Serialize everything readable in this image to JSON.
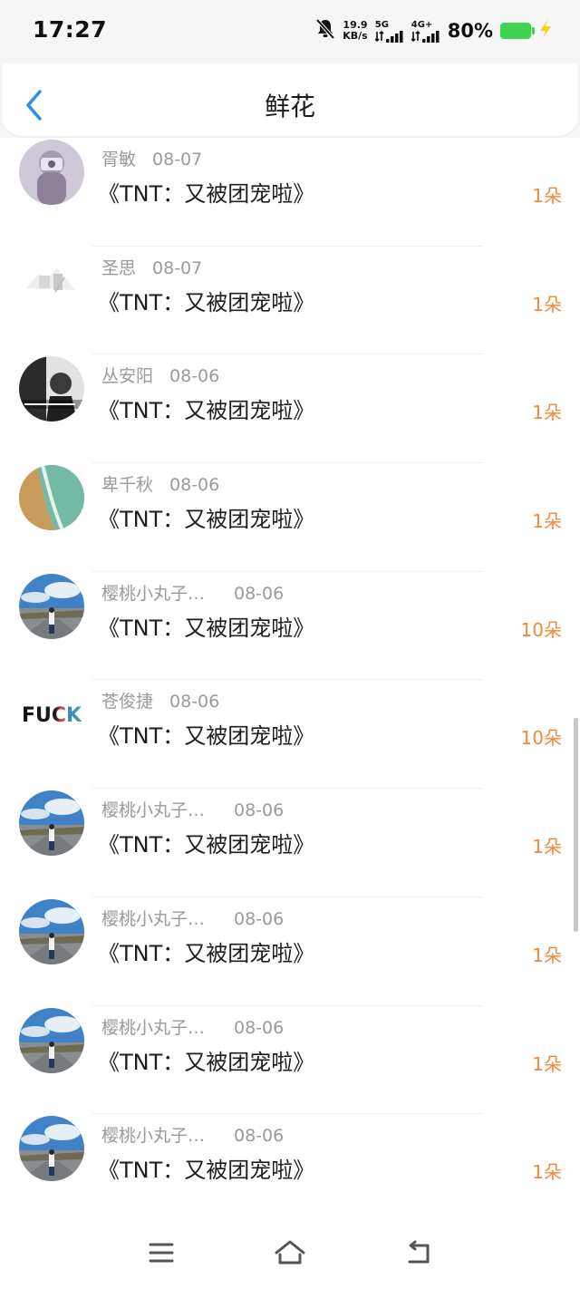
{
  "status_bar": {
    "time": "17:27",
    "net_speed_value": "19.9",
    "net_speed_unit": "KB/s",
    "sim1_label": "5G",
    "sim2_label": "4G+",
    "battery_percent": "80%",
    "icons": [
      "bell-muted-icon",
      "signal-icon",
      "battery-icon",
      "charging-bolt-icon"
    ]
  },
  "header": {
    "title": "鲜花",
    "back_icon": "chevron-left-icon"
  },
  "colors": {
    "accent_blue": "#2f8ee8",
    "count_orange": "#f08a3a",
    "battery_green": "#3fd452"
  },
  "items": [
    {
      "name": "胥敏",
      "date": "08-07",
      "book": "《TNT：又被团宠啦》",
      "count": "1朵",
      "avatar": "blurred-photo-avatar"
    },
    {
      "name": "圣思",
      "date": "08-07",
      "book": "《TNT：又被团宠啦》",
      "count": "1朵",
      "avatar": "sketch-avatar"
    },
    {
      "name": "丛安阳",
      "date": "08-06",
      "book": "《TNT：又被团宠啦》",
      "count": "1朵",
      "avatar": "bw-portrait-avatar"
    },
    {
      "name": "卑千秋",
      "date": "08-06",
      "book": "《TNT：又被团宠啦》",
      "count": "1朵",
      "avatar": "beach-avatar"
    },
    {
      "name": "樱桃小丸子…",
      "date": "08-06",
      "book": "《TNT：又被团宠啦》",
      "count": "10朵",
      "avatar": "landscape-person-avatar"
    },
    {
      "name": "苍俊捷",
      "date": "08-06",
      "book": "《TNT：又被团宠啦》",
      "count": "10朵",
      "avatar": "text-logo-avatar",
      "avatar_text": "FUCK"
    },
    {
      "name": "樱桃小丸子…",
      "date": "08-06",
      "book": "《TNT：又被团宠啦》",
      "count": "1朵",
      "avatar": "landscape-person-avatar"
    },
    {
      "name": "樱桃小丸子…",
      "date": "08-06",
      "book": "《TNT：又被团宠啦》",
      "count": "1朵",
      "avatar": "landscape-person-avatar"
    },
    {
      "name": "樱桃小丸子…",
      "date": "08-06",
      "book": "《TNT：又被团宠啦》",
      "count": "1朵",
      "avatar": "landscape-person-avatar"
    },
    {
      "name": "樱桃小丸子…",
      "date": "08-06",
      "book": "《TNT：又被团宠啦》",
      "count": "1朵",
      "avatar": "landscape-person-avatar"
    }
  ],
  "navbar": {
    "icons": [
      "menu-icon",
      "home-icon",
      "back-icon"
    ]
  }
}
